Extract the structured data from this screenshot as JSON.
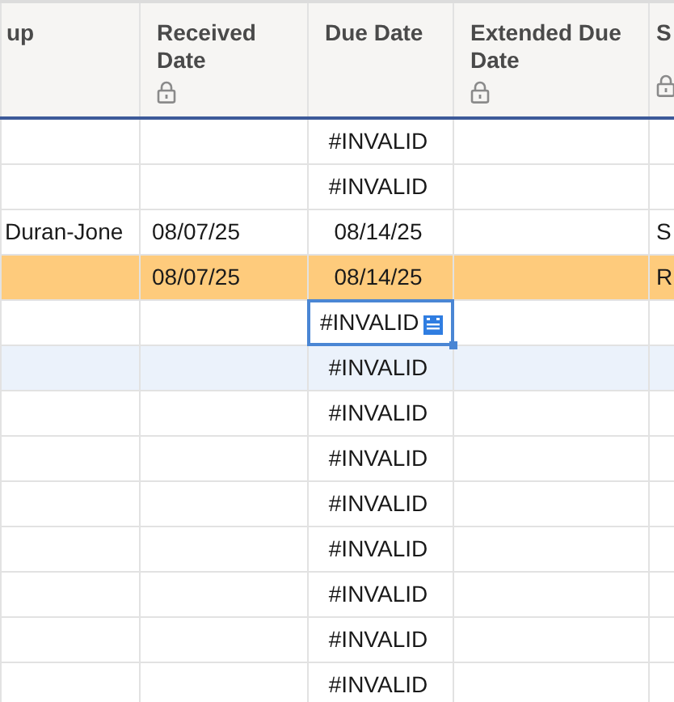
{
  "columns": [
    {
      "label": "up",
      "locked": false
    },
    {
      "label": "Received Date",
      "locked": true
    },
    {
      "label": "Due Date",
      "locked": false
    },
    {
      "label": "Extended Due Date",
      "locked": true
    },
    {
      "label": "S",
      "locked": true
    }
  ],
  "rows": [
    {
      "due_date": "#INVALID",
      "highlighted": false,
      "hovered": false,
      "selected": false
    },
    {
      "due_date": "#INVALID",
      "highlighted": false,
      "hovered": false,
      "selected": false
    },
    {
      "column_1": "Duran-Jone",
      "received_date": "08/07/25",
      "due_date": "08/14/25",
      "column_5": "S",
      "highlighted": false,
      "hovered": false,
      "selected": false
    },
    {
      "received_date": "08/07/25",
      "due_date": "08/14/25",
      "column_5": "R",
      "highlighted": true,
      "hovered": false,
      "selected": false
    },
    {
      "due_date": "#INVALID",
      "highlighted": false,
      "hovered": false,
      "selected": true
    },
    {
      "due_date": "#INVALID",
      "highlighted": false,
      "hovered": true,
      "selected": false
    },
    {
      "due_date": "#INVALID",
      "highlighted": false,
      "hovered": false,
      "selected": false
    },
    {
      "due_date": "#INVALID",
      "highlighted": false,
      "hovered": false,
      "selected": false
    },
    {
      "due_date": "#INVALID",
      "highlighted": false,
      "hovered": false,
      "selected": false
    },
    {
      "due_date": "#INVALID",
      "highlighted": false,
      "hovered": false,
      "selected": false
    },
    {
      "due_date": "#INVALID",
      "highlighted": false,
      "hovered": false,
      "selected": false
    },
    {
      "due_date": "#INVALID",
      "highlighted": false,
      "hovered": false,
      "selected": false
    },
    {
      "due_date": "#INVALID",
      "highlighted": false,
      "hovered": false,
      "selected": false
    }
  ]
}
